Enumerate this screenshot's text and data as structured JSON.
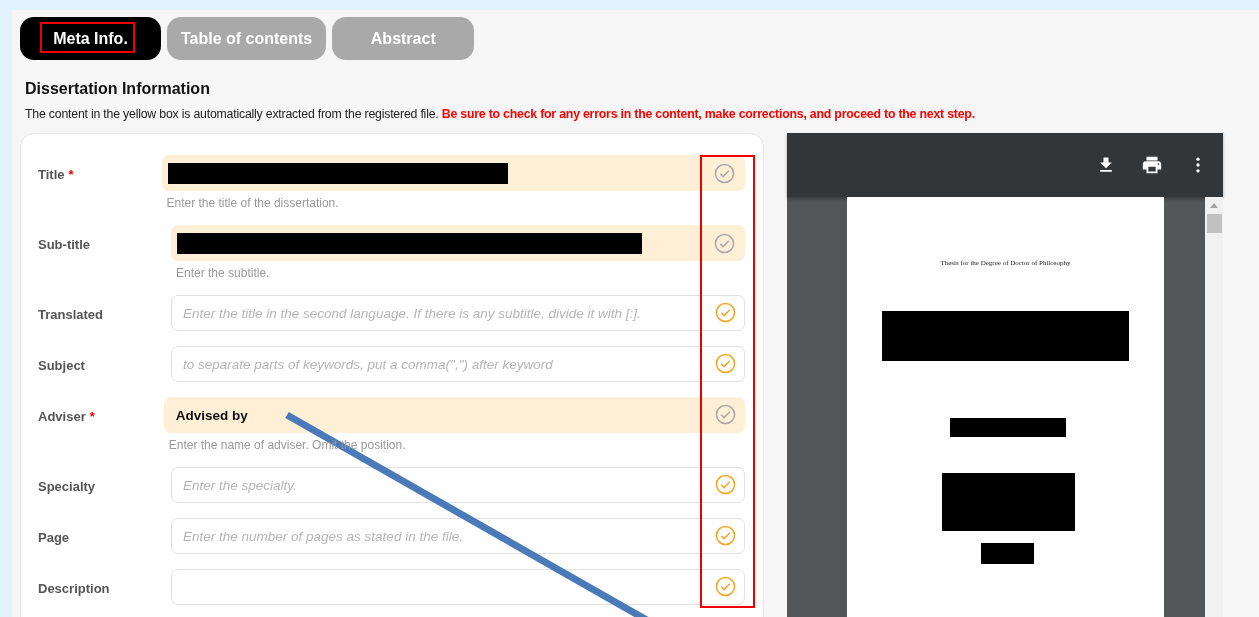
{
  "tabs": [
    {
      "label": "Meta Info.",
      "selected": true,
      "highlighted": true
    },
    {
      "label": "Table of contents",
      "selected": false,
      "highlighted": false
    },
    {
      "label": "Abstract",
      "selected": false,
      "highlighted": false
    }
  ],
  "heading": "Dissertation Information",
  "notice": {
    "text": "The content in the yellow box is automatically extracted from the registered file.",
    "warning": "Be sure to check for any errors in the content, make corrections, and proceed to the next step."
  },
  "form": {
    "check_column_highlighted": true,
    "annotation_line": true,
    "fields": [
      {
        "label": "Title",
        "required_mark": "*",
        "kind": "redacted",
        "extracted": true,
        "hint": "Enter the title of the dissertation."
      },
      {
        "label": "Sub-title",
        "kind": "redacted",
        "extracted": true,
        "hint": "Enter the subtitle."
      },
      {
        "label": "Translated",
        "kind": "input",
        "extracted": false,
        "placeholder": "Enter the title in the second language. If there is any subtitle, divide it with [:]."
      },
      {
        "label": "Subject",
        "kind": "input",
        "extracted": false,
        "placeholder": "to separate parts of keywords, put a comma(\",\") after keyword"
      },
      {
        "label": "Adviser",
        "required_mark": "*",
        "kind": "input",
        "extracted": true,
        "value": "Advised by",
        "hint": "Enter the name of adviser. Omit the position."
      },
      {
        "label": "Specialty",
        "kind": "input",
        "extracted": false,
        "placeholder": "Enter the specialty."
      },
      {
        "label": "Page",
        "kind": "input",
        "extracted": false,
        "placeholder": "Enter the number of pages as stated in the file."
      },
      {
        "label": "Description",
        "kind": "input",
        "extracted": false
      }
    ]
  },
  "viewer": {
    "page_heading": "Thesis for the Degree of Doctor of Philosophy"
  }
}
